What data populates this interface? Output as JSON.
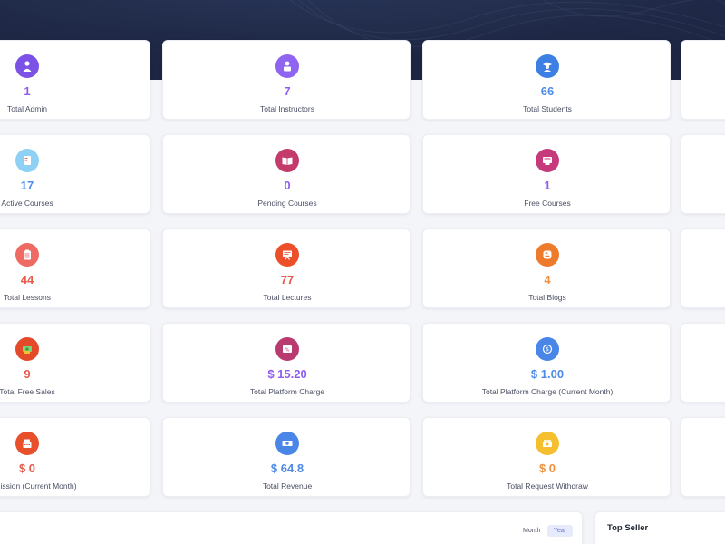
{
  "colors": {
    "header_bg": "#1c2541",
    "purple": "#8e5cf2",
    "blue": "#4e8be8",
    "red": "#e65a4b",
    "orange": "#f0903d",
    "yellow": "#f5c030",
    "pink": "#c43a6b"
  },
  "cards": [
    {
      "id": "total-admin",
      "value": "1",
      "label": "Total Admin",
      "icon": "admin-icon",
      "color": "#8e5cf2",
      "icon_bg": "#7b51e6"
    },
    {
      "id": "total-instructors",
      "value": "7",
      "label": "Total Instructors",
      "icon": "instructor-icon",
      "color": "#8e5cf2",
      "icon_bg": "#8f64f0"
    },
    {
      "id": "total-students",
      "value": "66",
      "label": "Total Students",
      "icon": "student-icon",
      "color": "#4e8be8",
      "icon_bg": "#3d7fe3"
    },
    {
      "id": "active-courses",
      "value": "17",
      "label": "Active Courses",
      "icon": "course-icon",
      "color": "#4e8be8",
      "icon_bg": "#8fd0f5"
    },
    {
      "id": "pending-courses",
      "value": "0",
      "label": "Pending Courses",
      "icon": "book-icon",
      "color": "#8e5cf2",
      "icon_bg": "#c43a6b"
    },
    {
      "id": "free-courses",
      "value": "1",
      "label": "Free Courses",
      "icon": "certificate-icon",
      "color": "#8e5cf2",
      "icon_bg": "#c43a7b"
    },
    {
      "id": "total-lessons",
      "value": "44",
      "label": "Total Lessons",
      "icon": "clipboard-icon",
      "color": "#e65a4b",
      "icon_bg": "#ee6a63"
    },
    {
      "id": "total-lectures",
      "value": "77",
      "label": "Total Lectures",
      "icon": "presentation-icon",
      "color": "#e65a4b",
      "icon_bg": "#ec4f2a"
    },
    {
      "id": "total-blogs",
      "value": "4",
      "label": "Total Blogs",
      "icon": "blog-icon",
      "color": "#f0903d",
      "icon_bg": "#ee7a2c"
    },
    {
      "id": "total-free-sales",
      "value": "9",
      "label": "Total Free Sales",
      "icon": "sales-icon",
      "color": "#e65a4b",
      "icon_bg": "#e34a2a"
    },
    {
      "id": "total-platform-charge",
      "value": "$ 15.20",
      "label": "Total Platform Charge",
      "icon": "percent-icon",
      "color": "#8e5cf2",
      "icon_bg": "#b83a6f"
    },
    {
      "id": "total-platform-charge-month",
      "value": "$ 1.00",
      "label": "Total Platform Charge (Current Month)",
      "icon": "money-icon",
      "color": "#4e8be8",
      "icon_bg": "#4a86e8"
    },
    {
      "id": "commission-month",
      "value": "$ 0",
      "label": "Commission (Current Month)",
      "icon": "cash-register-icon",
      "color": "#e65a4b",
      "icon_bg": "#e8502c"
    },
    {
      "id": "total-revenue",
      "value": "$ 64.8",
      "label": "Total Revenue",
      "icon": "revenue-icon",
      "color": "#4e8be8",
      "icon_bg": "#4a86e8"
    },
    {
      "id": "total-request-withdraw",
      "value": "$ 0",
      "label": "Total Request Withdraw",
      "icon": "withdraw-icon",
      "color": "#f0903d",
      "icon_bg": "#f5c030"
    }
  ],
  "chart_panel": {
    "tab_month": "Month",
    "tab_year": "Year",
    "active_tab": "Year"
  },
  "top_seller": {
    "title": "Top Seller"
  }
}
